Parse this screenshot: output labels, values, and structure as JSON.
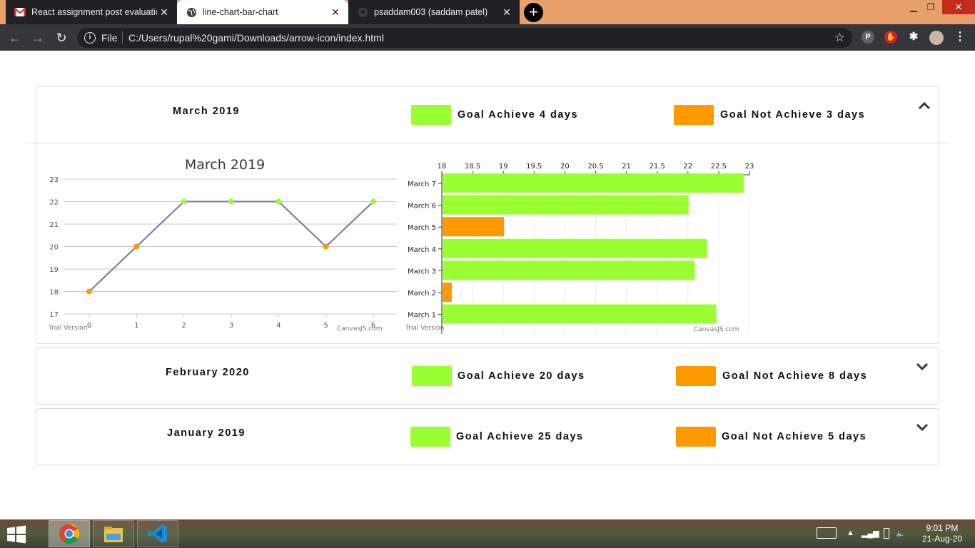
{
  "browser": {
    "tabs": [
      {
        "title": "React assignment post evaluation",
        "icon": "gmail-icon",
        "active": false
      },
      {
        "title": "line-chart-bar-chart",
        "icon": "globe-icon",
        "active": true
      },
      {
        "title": "psaddam003 (saddam patel)",
        "icon": "github-icon",
        "active": false
      }
    ],
    "new_tab_label": "+",
    "omnibox": {
      "scheme_label": "File",
      "url": "C:/Users/rupal%20gami/Downloads/arrow-icon/index.html"
    }
  },
  "legend_colors": {
    "achieve": "#99ff33",
    "not_achieve": "#ff9900"
  },
  "cards": [
    {
      "title": "March 2019",
      "achieve_label": "Goal Achieve 4 days",
      "not_achieve_label": "Goal Not Achieve 3 days",
      "expanded": true,
      "chevron": "chevron-up-icon"
    },
    {
      "title": "February 2020",
      "achieve_label": "Goal Achieve 20 days",
      "not_achieve_label": "Goal Not Achieve 8 days",
      "expanded": false,
      "chevron": "chevron-down-icon"
    },
    {
      "title": "January 2019",
      "achieve_label": "Goal Achieve 25 days",
      "not_achieve_label": "Goal Not Achieve 5 days",
      "expanded": false,
      "chevron": "chevron-down-icon"
    }
  ],
  "chart_data": [
    {
      "type": "line",
      "title": "March 2019",
      "x": [
        0,
        1,
        2,
        3,
        4,
        5,
        6
      ],
      "y": [
        18,
        20,
        22,
        22,
        22,
        20,
        22
      ],
      "point_status": [
        "not_achieve",
        "not_achieve",
        "achieve",
        "achieve",
        "achieve",
        "not_achieve",
        "achieve"
      ],
      "ylim": [
        17,
        23
      ],
      "yticks": [
        17,
        18,
        19,
        20,
        21,
        22,
        23
      ],
      "xticks": [
        0,
        1,
        2,
        3,
        4,
        5,
        6
      ],
      "grid": true,
      "line_color": "#6d78ad",
      "watermark_left": "Trial Version",
      "watermark_right": "CanvasJS.com"
    },
    {
      "type": "bar",
      "orientation": "horizontal",
      "categories": [
        "March 7",
        "March 6",
        "March 5",
        "March 4",
        "March 3",
        "March 2",
        "March 1"
      ],
      "values": [
        22.9,
        22,
        19,
        22.3,
        22.1,
        18.15,
        22.45
      ],
      "bar_status": [
        "achieve",
        "achieve",
        "not_achieve",
        "achieve",
        "achieve",
        "not_achieve",
        "achieve"
      ],
      "xlim": [
        18,
        23
      ],
      "xticks": [
        "18",
        "18.5",
        "19",
        "19.5",
        "20",
        "20.5",
        "21",
        "21.5",
        "22",
        "22.5",
        "23"
      ],
      "axis_position": "top",
      "watermark_left": "Trial Version",
      "watermark_right": "CanvasJS.com"
    }
  ],
  "taskbar": {
    "apps": [
      "chrome-icon",
      "file-explorer-icon",
      "vscode-icon"
    ],
    "time": "9:01 PM",
    "date": "21-Aug-20"
  }
}
